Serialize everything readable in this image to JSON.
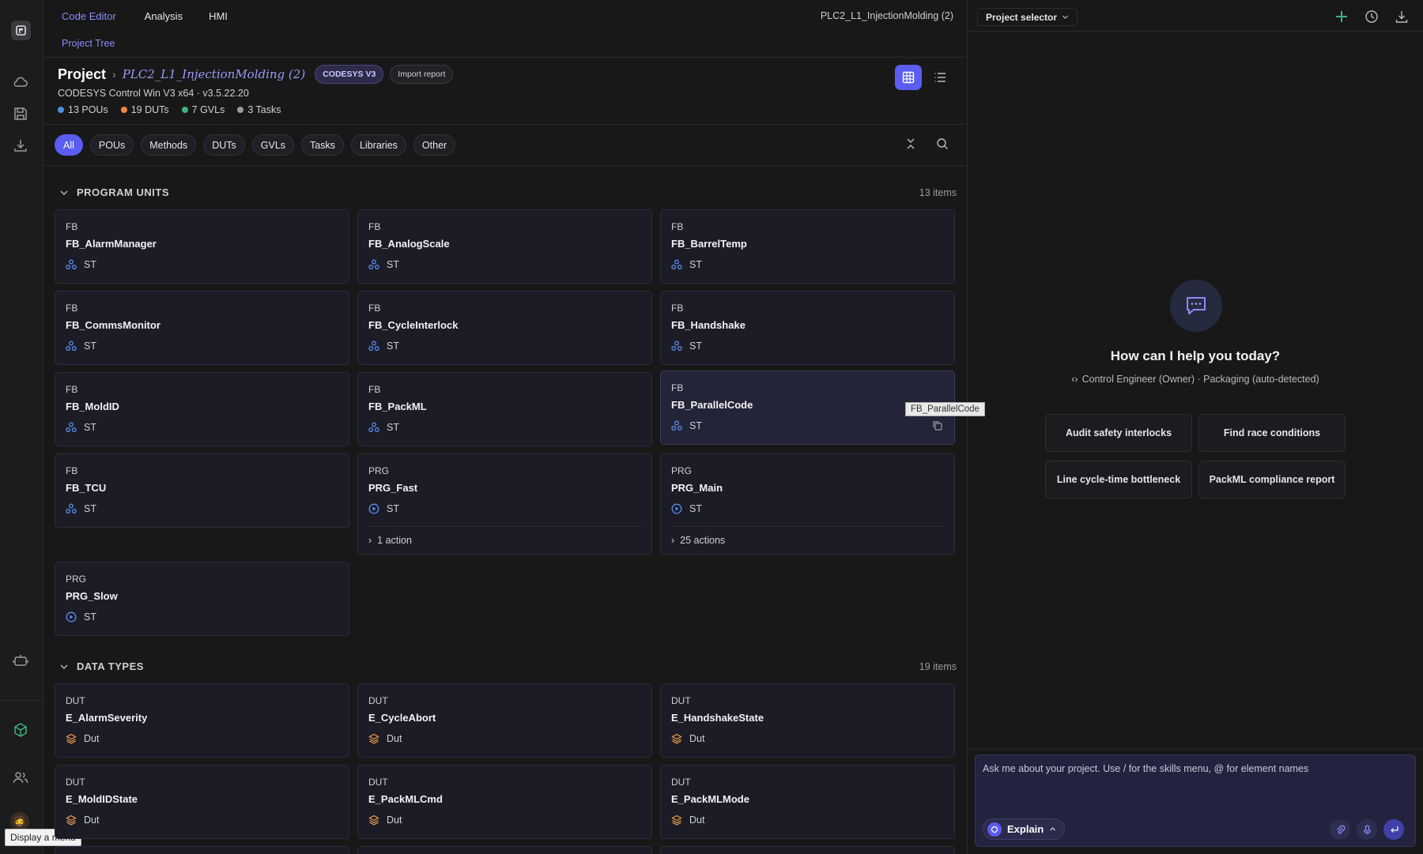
{
  "nav": {
    "tabs": [
      "Code Editor",
      "Analysis",
      "HMI"
    ],
    "sub_tab": "Project Tree",
    "project_file": "PLC2_L1_InjectionMolding (2)"
  },
  "header": {
    "title": "Project",
    "project_name": "PLC2_L1_InjectionMolding (2)",
    "badge": "CODESYS V3",
    "import_report": "Import report",
    "runtime": "CODESYS Control Win V3 x64 · v3.5.22.20",
    "stats": [
      {
        "label": "13 POUs",
        "color": "#4a90e2"
      },
      {
        "label": "19 DUTs",
        "color": "#f0883e"
      },
      {
        "label": "7 GVLs",
        "color": "#3fb17a"
      },
      {
        "label": "3 Tasks",
        "color": "#9a9aa2"
      }
    ]
  },
  "filters": [
    "All",
    "POUs",
    "Methods",
    "DUTs",
    "GVLs",
    "Tasks",
    "Libraries",
    "Other"
  ],
  "sections": {
    "program_units": {
      "title": "PROGRAM UNITS",
      "count": "13 items"
    },
    "data_types": {
      "title": "DATA TYPES",
      "count": "19 items"
    }
  },
  "program_units": [
    {
      "kind": "FB",
      "name": "FB_AlarmManager",
      "lang": "ST",
      "icon": "fb-icon"
    },
    {
      "kind": "FB",
      "name": "FB_AnalogScale",
      "lang": "ST",
      "icon": "fb-icon"
    },
    {
      "kind": "FB",
      "name": "FB_BarrelTemp",
      "lang": "ST",
      "icon": "fb-icon"
    },
    {
      "kind": "FB",
      "name": "FB_CommsMonitor",
      "lang": "ST",
      "icon": "fb-icon"
    },
    {
      "kind": "FB",
      "name": "FB_CycleInterlock",
      "lang": "ST",
      "icon": "fb-icon"
    },
    {
      "kind": "FB",
      "name": "FB_Handshake",
      "lang": "ST",
      "icon": "fb-icon"
    },
    {
      "kind": "FB",
      "name": "FB_MoldID",
      "lang": "ST",
      "icon": "fb-icon"
    },
    {
      "kind": "FB",
      "name": "FB_PackML",
      "lang": "ST",
      "icon": "fb-icon"
    },
    {
      "kind": "FB",
      "name": "FB_ParallelCode",
      "lang": "ST",
      "icon": "fb-icon"
    },
    {
      "kind": "FB",
      "name": "FB_TCU",
      "lang": "ST",
      "icon": "fb-icon"
    },
    {
      "kind": "PRG",
      "name": "PRG_Fast",
      "lang": "ST",
      "icon": "prg-icon",
      "actions": "1 action"
    },
    {
      "kind": "PRG",
      "name": "PRG_Main",
      "lang": "ST",
      "icon": "prg-icon",
      "actions": "25 actions"
    },
    {
      "kind": "PRG",
      "name": "PRG_Slow",
      "lang": "ST",
      "icon": "prg-icon"
    }
  ],
  "hover_tooltip": "FB_ParallelCode",
  "data_types": [
    {
      "kind": "DUT",
      "name": "E_AlarmSeverity",
      "lang": "Dut"
    },
    {
      "kind": "DUT",
      "name": "E_CycleAbort",
      "lang": "Dut"
    },
    {
      "kind": "DUT",
      "name": "E_HandshakeState",
      "lang": "Dut"
    },
    {
      "kind": "DUT",
      "name": "E_MoldIDState",
      "lang": "Dut"
    },
    {
      "kind": "DUT",
      "name": "E_PackMLCmd",
      "lang": "Dut"
    },
    {
      "kind": "DUT",
      "name": "E_PackMLMode",
      "lang": "Dut"
    }
  ],
  "assistant": {
    "project_selector": "Project selector",
    "title": "How can I help you today?",
    "context": "Control Engineer (Owner) · Packaging (auto-detected)",
    "suggestions": [
      "Audit safety interlocks",
      "Find race conditions",
      "Line cycle-time bottleneck",
      "PackML compliance report"
    ],
    "placeholder": "Ask me about your project. Use / for the skills menu, @ for element names",
    "mode": "Explain"
  },
  "rail": {
    "menu_tooltip": "Display a menu"
  },
  "colors": {
    "accent": "#5b5cf0",
    "link": "#8b8cf8",
    "fb_icon": "#5b8def",
    "dut_icon": "#f0a04b",
    "add": "#3fb17a"
  }
}
